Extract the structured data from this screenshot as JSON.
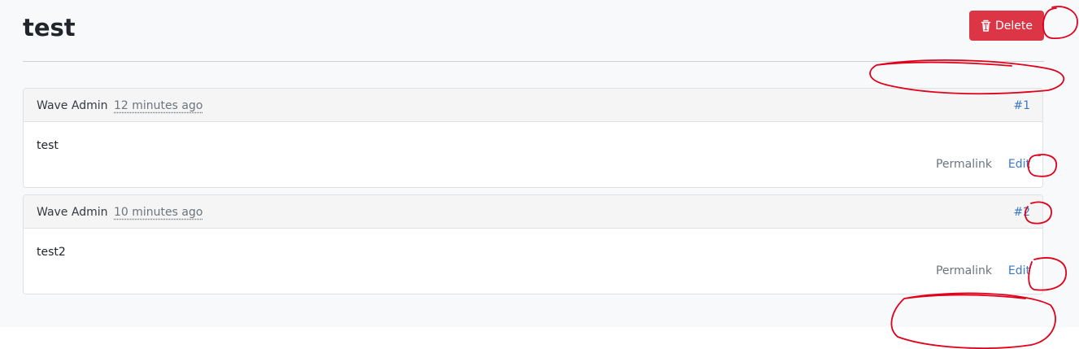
{
  "page": {
    "title": "test"
  },
  "toolbar": {
    "delete_label": "Delete",
    "delete_icon": "trash-icon",
    "delete_color": "#dc3545"
  },
  "comments": [
    {
      "author": "Wave Admin",
      "time": "12 minutes ago",
      "anchor": "#1",
      "body": "test",
      "permalink": "Permalink",
      "edit": "Edit"
    },
    {
      "author": "Wave Admin",
      "time": "10 minutes ago",
      "anchor": "#2",
      "body": "test2",
      "permalink": "Permalink",
      "edit": "Edit"
    }
  ],
  "annotations": {
    "color": "#e0001b",
    "style": "hand-drawn circles"
  }
}
